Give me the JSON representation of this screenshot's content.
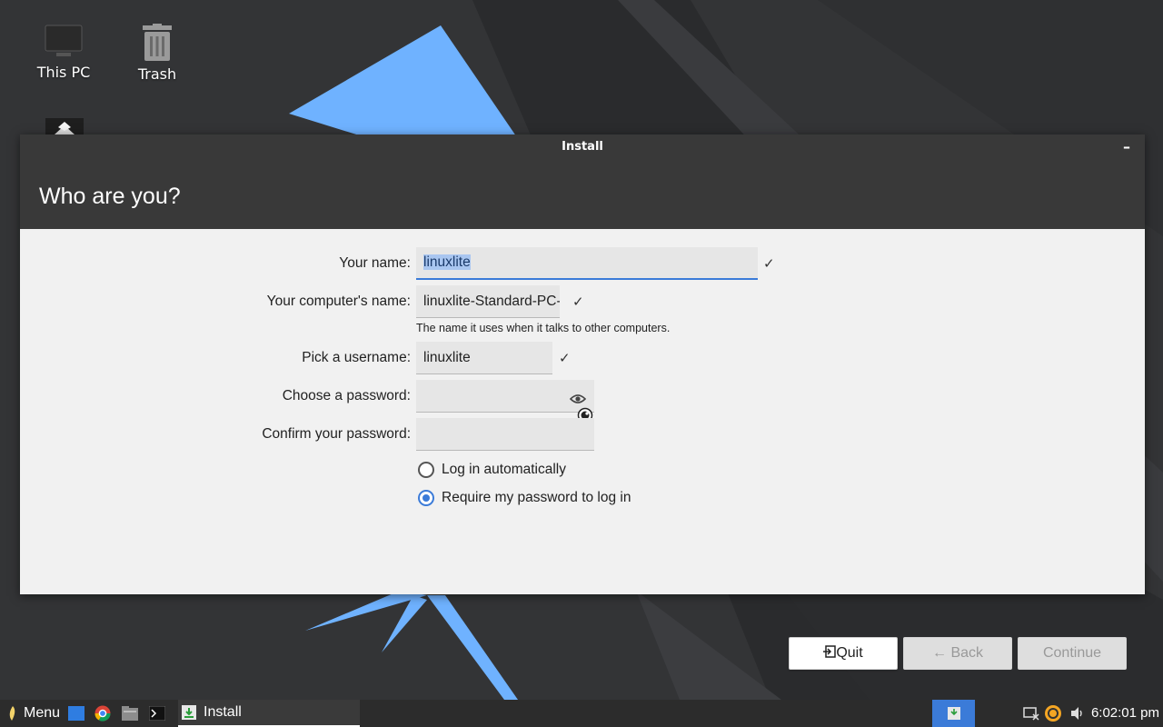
{
  "desktop": {
    "icons": [
      {
        "label": "This PC",
        "icon": "computer-icon"
      },
      {
        "label": "Trash",
        "icon": "trash-icon"
      }
    ]
  },
  "window": {
    "title": "Install",
    "minimize_glyph": "–"
  },
  "page": {
    "heading": "Who are you?"
  },
  "form": {
    "name_label": "Your name:",
    "name_value": "linuxlite",
    "computer_label": "Your computer's name:",
    "computer_value": "linuxlite-Standard-PC-",
    "computer_hint": "The name it uses when it talks to other computers.",
    "username_label": "Pick a username:",
    "username_value": "linuxlite",
    "password_label": "Choose a password:",
    "password_value": "",
    "confirm_label": "Confirm your password:",
    "confirm_value": "",
    "check_glyph": "✓"
  },
  "login": {
    "auto_label": "Log in automatically",
    "require_label": "Require my password to log in",
    "selected": "require"
  },
  "buttons": {
    "quit": "Quit",
    "back": "Back",
    "continue": "Continue"
  },
  "taskbar": {
    "menu_label": "Menu",
    "task_label": "Install",
    "clock": "6:02:01 pm"
  },
  "colors": {
    "accent": "#3b7bd8",
    "window_header": "#393939",
    "wallpaper_blue": "#6fb2ff"
  }
}
